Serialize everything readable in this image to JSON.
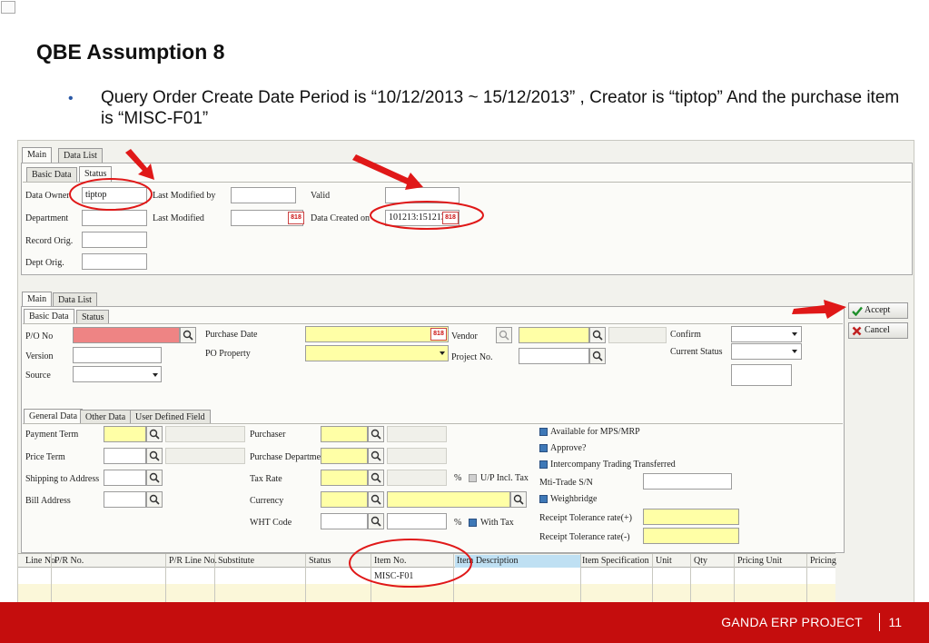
{
  "slide": {
    "title": "QBE Assumption 8",
    "bullet": "Query Order Create Date Period is “10/12/2013 ~ 15/12/2013” , Creator is “tiptop” And the purchase item is “MISC-F01”",
    "footer_project": "GANDA ERP PROJECT",
    "footer_page": "11"
  },
  "top_form": {
    "tabs": [
      "Main",
      "Data List"
    ],
    "subtabs": [
      "Basic Data",
      "Status"
    ],
    "data_owner_label": "Data Owner",
    "data_owner_value": "tiptop",
    "department_label": "Department",
    "record_orig_label": "Record Orig.",
    "dept_orig_label": "Dept Orig.",
    "last_modified_by_label": "Last Modified by",
    "last_modified_label": "Last Modified",
    "valid_label": "Valid",
    "data_created_on_label": "Data Created on",
    "data_created_on_value": "101213:151213"
  },
  "bottom_form": {
    "tabs": [
      "Main",
      "Data List"
    ],
    "subtabs": [
      "Basic Data",
      "Status"
    ],
    "po_no_label": "P/O No",
    "version_label": "Version",
    "source_label": "Source",
    "purchase_date_label": "Purchase Date",
    "po_property_label": "PO Property",
    "vendor_label": "Vendor",
    "project_no_label": "Project No.",
    "confirm_label": "Confirm",
    "current_status_label": "Current Status",
    "accept_label": "Accept",
    "cancel_label": "Cancel",
    "detail_tabs": [
      "General Data",
      "Other Data",
      "User Defined Field"
    ],
    "payment_term_label": "Payment Term",
    "price_term_label": "Price Term",
    "shipping_address_label": "Shipping to Address",
    "bill_address_label": "Bill Address",
    "purchaser_label": "Purchaser",
    "purchase_department_label": "Purchase Department",
    "tax_rate_label": "Tax Rate",
    "currency_label": "Currency",
    "wht_code_label": "WHT Code",
    "percent_sign": "%",
    "up_incl_tax_label": "U/P Incl. Tax",
    "with_tax_label": "With Tax",
    "available_mps_label": "Available for MPS/MRP",
    "approve_label": "Approve?",
    "intercompany_label": "Intercompany Trading Transferred",
    "mti_trade_label": "Mti-Trade S/N",
    "weighbridge_label": "Weighbridge",
    "receipt_tol_plus_label": "Receipt Tolerance rate(+)",
    "receipt_tol_minus_label": "Receipt Tolerance rate(-)",
    "calendar_icon_text": "818"
  },
  "grid": {
    "columns": [
      "Line No",
      "P/R No.",
      "P/R Line No.",
      "Substitute",
      "Status",
      "Item No.",
      "Item Description",
      "Item Specification",
      "Unit",
      "Qty",
      "Pricing Unit",
      "Pricing"
    ],
    "rows": [
      {
        "item_no": "MISC-F01"
      }
    ]
  },
  "colors": {
    "footer_red": "#c50d0d",
    "annotation_red": "#e01818",
    "yellow_field": "#ffffa6",
    "pink_field": "#ee8484",
    "checkbox_blue": "#3e78b7"
  }
}
